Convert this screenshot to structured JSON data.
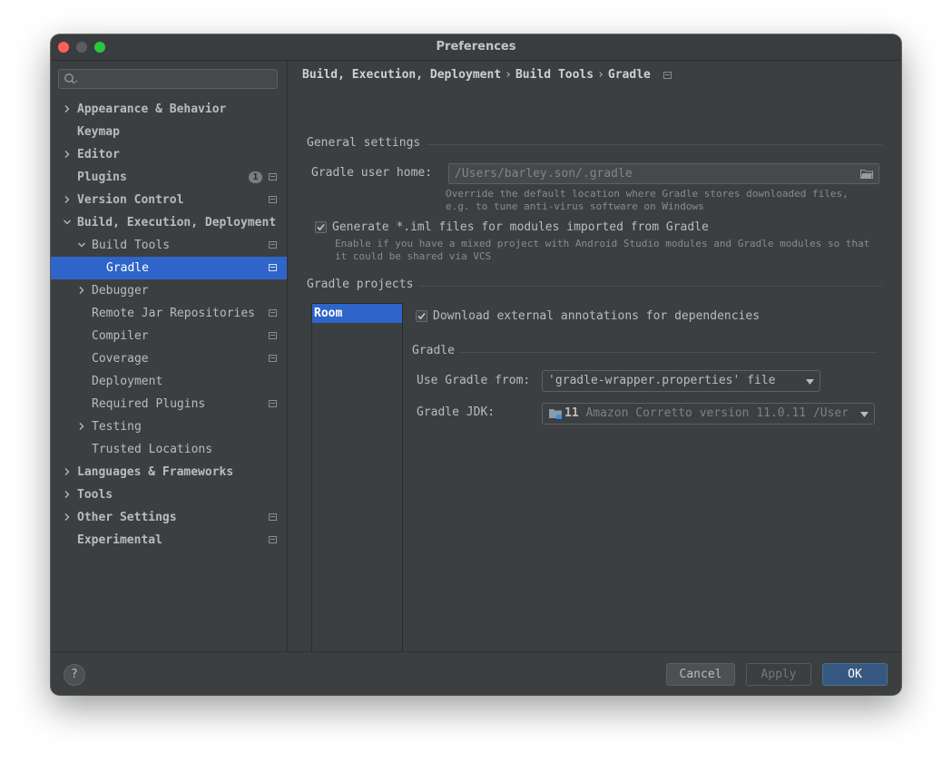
{
  "window": {
    "title": "Preferences"
  },
  "search": {
    "placeholder": ""
  },
  "sidebar": {
    "items": [
      {
        "label": "Appearance & Behavior",
        "level": 0,
        "chevron": "right",
        "bold": true
      },
      {
        "label": "Keymap",
        "level": 0,
        "chevron": "",
        "bold": true
      },
      {
        "label": "Editor",
        "level": 0,
        "chevron": "right",
        "bold": true
      },
      {
        "label": "Plugins",
        "level": 0,
        "chevron": "",
        "bold": true,
        "badge": "1",
        "project_icon": true
      },
      {
        "label": "Version Control",
        "level": 0,
        "chevron": "right",
        "bold": true,
        "project_icon": true
      },
      {
        "label": "Build, Execution, Deployment",
        "level": 0,
        "chevron": "down",
        "bold": true
      },
      {
        "label": "Build Tools",
        "level": 1,
        "chevron": "down",
        "project_icon": true
      },
      {
        "label": "Gradle",
        "level": 2,
        "chevron": "",
        "selected": true,
        "project_icon": true
      },
      {
        "label": "Debugger",
        "level": 1,
        "chevron": "right"
      },
      {
        "label": "Remote Jar Repositories",
        "level": 1,
        "chevron": "",
        "project_icon": true
      },
      {
        "label": "Compiler",
        "level": 1,
        "chevron": "",
        "project_icon": true
      },
      {
        "label": "Coverage",
        "level": 1,
        "chevron": "",
        "project_icon": true
      },
      {
        "label": "Deployment",
        "level": 1,
        "chevron": ""
      },
      {
        "label": "Required Plugins",
        "level": 1,
        "chevron": "",
        "project_icon": true
      },
      {
        "label": "Testing",
        "level": 1,
        "chevron": "right"
      },
      {
        "label": "Trusted Locations",
        "level": 1,
        "chevron": ""
      },
      {
        "label": "Languages & Frameworks",
        "level": 0,
        "chevron": "right",
        "bold": true
      },
      {
        "label": "Tools",
        "level": 0,
        "chevron": "right",
        "bold": true
      },
      {
        "label": "Other Settings",
        "level": 0,
        "chevron": "right",
        "bold": true,
        "project_icon": true
      },
      {
        "label": "Experimental",
        "level": 0,
        "chevron": "",
        "bold": true,
        "project_icon": true
      }
    ]
  },
  "breadcrumb": {
    "items": [
      "Build, Execution, Deployment",
      "Build Tools",
      "Gradle"
    ],
    "separator": "›"
  },
  "general": {
    "title": "General settings",
    "user_home_label": "Gradle user home:",
    "user_home_placeholder": "/Users/barley.son/.gradle",
    "user_home_hint_1": "Override the default location where Gradle stores downloaded files,",
    "user_home_hint_2": "e.g. to tune anti-virus software on Windows",
    "iml_label": "Generate *.iml files for modules imported from Gradle",
    "iml_checked": true,
    "iml_hint_1": "Enable if you have a mixed project with Android Studio modules and Gradle modules so that",
    "iml_hint_2": "it could be shared via VCS"
  },
  "projects": {
    "title": "Gradle projects",
    "list": [
      "Room"
    ],
    "download_label": "Download external annotations for dependencies",
    "download_checked": true,
    "gradle_title": "Gradle",
    "use_from_label": "Use Gradle from:",
    "use_from_value": "'gradle-wrapper.properties' file",
    "jdk_label": "Gradle JDK:",
    "jdk_version": "11",
    "jdk_value": "Amazon Corretto version 11.0.11 /User"
  },
  "footer": {
    "help": "?",
    "cancel": "Cancel",
    "apply": "Apply",
    "ok": "OK"
  },
  "colors": {
    "background": "#3c3f41",
    "selection": "#2f65ca",
    "accent_button": "#365880",
    "text": "#bbbbbb",
    "close": "#fe5f57",
    "maximize": "#2ac840"
  }
}
